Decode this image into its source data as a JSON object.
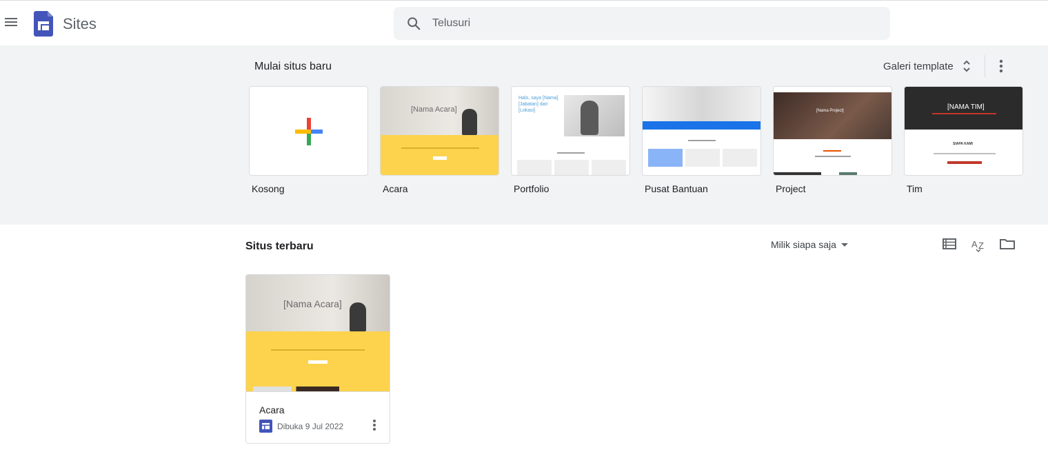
{
  "header": {
    "app_title": "Sites",
    "search_placeholder": "Telusuri"
  },
  "templates": {
    "heading": "Mulai situs baru",
    "gallery_label": "Galeri template",
    "items": [
      {
        "label": "Kosong"
      },
      {
        "label": "Acara",
        "thumb_title": "[Nama Acara]"
      },
      {
        "label": "Portfolio",
        "thumb_title": "Halo, saya [Nama] [Jabatan] dari [Lokasi]"
      },
      {
        "label": "Pusat Bantuan"
      },
      {
        "label": "Project",
        "thumb_title": "[Nama Project]"
      },
      {
        "label": "Tim",
        "thumb_title": "[NAMA TIM]",
        "thumb_sub": "SIAPA KAMI"
      }
    ]
  },
  "recent": {
    "heading": "Situs terbaru",
    "owner_filter": "Milik siapa saja",
    "sites": [
      {
        "title": "Acara",
        "meta": "Dibuka 9 Jul 2022",
        "thumb_title": "[Nama Acara]"
      }
    ]
  },
  "colors": {
    "accent_blue": "#4355b9",
    "event_yellow": "#fdd34e",
    "help_blue": "#1a73e8",
    "team_red": "#c0392b",
    "plus_red": "#ea4335",
    "plus_yellow": "#fbbc04",
    "plus_green": "#34a853",
    "plus_blue": "#4285f4"
  }
}
